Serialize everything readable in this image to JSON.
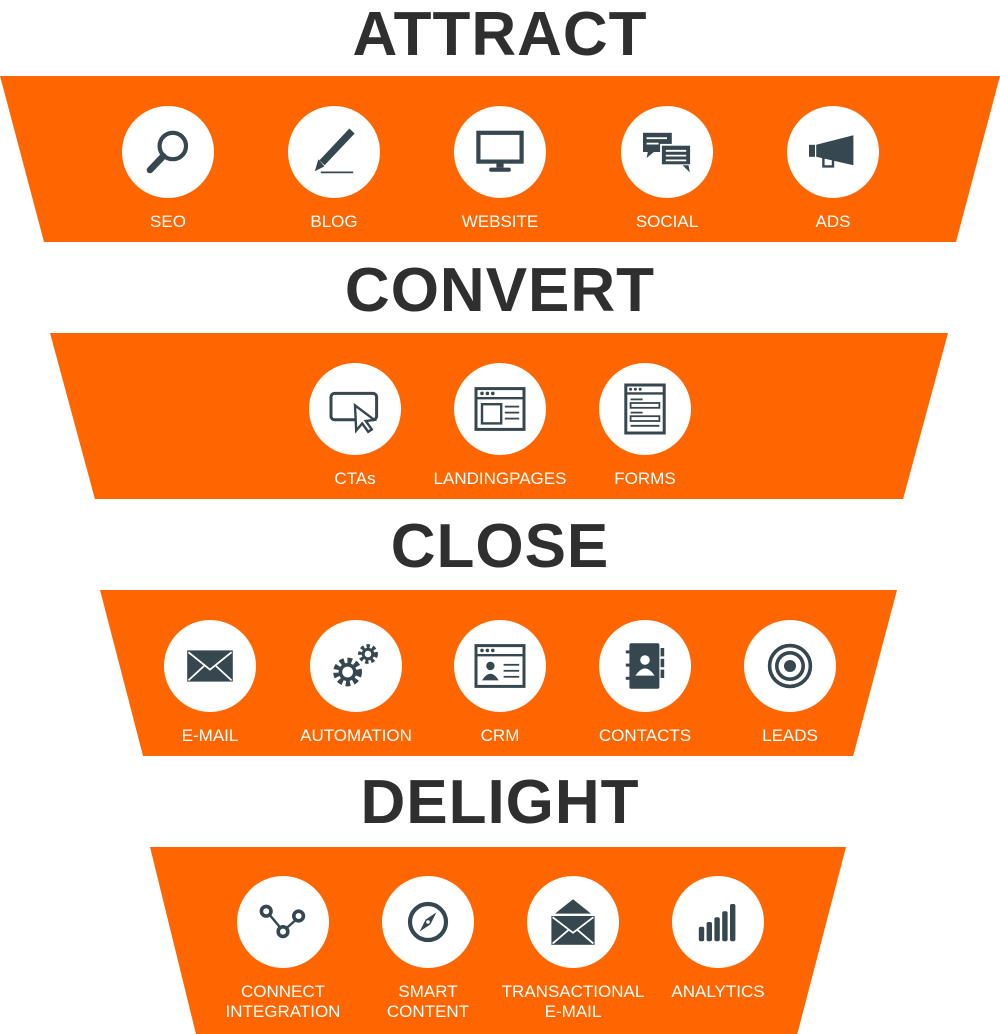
{
  "colors": {
    "accent": "#ff6600",
    "icon": "#37474f",
    "title": "#2f2f2f"
  },
  "stages": [
    {
      "title": "ATTRACT",
      "items": [
        {
          "label": "SEO",
          "icon": "search-icon"
        },
        {
          "label": "BLOG",
          "icon": "pencil-icon"
        },
        {
          "label": "WEBSITE",
          "icon": "monitor-icon"
        },
        {
          "label": "SOCIAL",
          "icon": "chat-bubbles-icon"
        },
        {
          "label": "ADS",
          "icon": "megaphone-icon"
        }
      ]
    },
    {
      "title": "CONVERT",
      "items": [
        {
          "label": "CTAs",
          "icon": "cursor-click-icon"
        },
        {
          "label": "LANDINGPAGES",
          "icon": "browser-window-icon"
        },
        {
          "label": "FORMS",
          "icon": "form-icon"
        }
      ]
    },
    {
      "title": "CLOSE",
      "items": [
        {
          "label": "E-MAIL",
          "icon": "envelope-icon"
        },
        {
          "label": "AUTOMATION",
          "icon": "gears-icon"
        },
        {
          "label": "CRM",
          "icon": "crm-window-icon"
        },
        {
          "label": "CONTACTS",
          "icon": "contact-book-icon"
        },
        {
          "label": "LEADS",
          "icon": "target-icon"
        }
      ]
    },
    {
      "title": "DELIGHT",
      "items": [
        {
          "label": "CONNECT",
          "label2": "INTEGRATION",
          "icon": "connect-nodes-icon"
        },
        {
          "label": "SMART",
          "label2": "CONTENT",
          "icon": "compass-icon"
        },
        {
          "label": "TRANSACTIONAL",
          "label2": "E-MAIL",
          "icon": "open-envelope-icon"
        },
        {
          "label": "ANALYTICS",
          "icon": "bar-chart-icon"
        }
      ]
    }
  ]
}
